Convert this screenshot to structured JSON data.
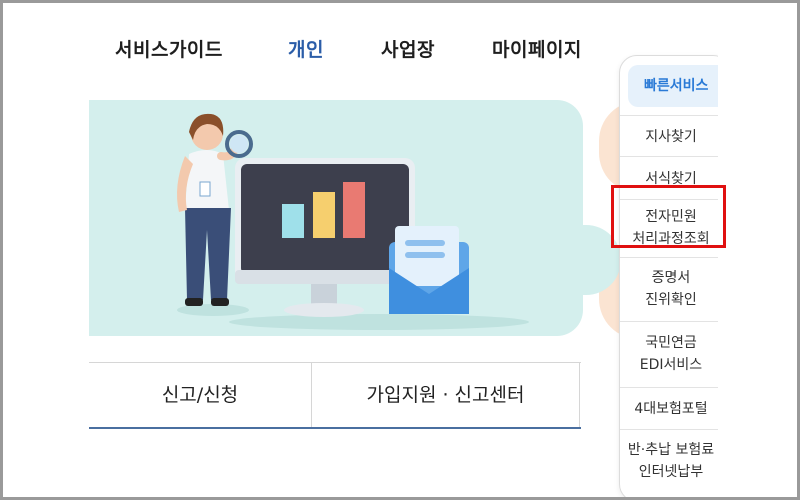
{
  "nav": {
    "items": [
      {
        "label": "서비스가이드"
      },
      {
        "label": "개인",
        "active": true
      },
      {
        "label": "사업장"
      },
      {
        "label": "마이페이지"
      }
    ],
    "active_color": "#2b5da8"
  },
  "hero": {
    "bg_color": "#d4efed",
    "illustration": [
      "woman-with-magnifier",
      "monitor-bar-chart",
      "mail-envelope"
    ]
  },
  "tabs": {
    "items": [
      {
        "label": "신고/신청"
      },
      {
        "label": "가입지원 · 신고센터"
      }
    ]
  },
  "quick": {
    "title": "빠른서비스",
    "items": [
      {
        "lines": [
          "지사찾기"
        ]
      },
      {
        "lines": [
          "서식찾기"
        ]
      },
      {
        "lines": [
          "전자민원",
          "처리과정조회"
        ],
        "highlighted": true
      },
      {
        "lines": [
          "증명서",
          "진위확인"
        ]
      },
      {
        "lines": [
          "국민연금",
          "EDI서비스"
        ]
      },
      {
        "lines": [
          "4대보험포털"
        ]
      },
      {
        "lines": [
          "반·추납 보험료",
          "인터넷납부"
        ]
      }
    ],
    "highlight_color": "#e01010"
  }
}
